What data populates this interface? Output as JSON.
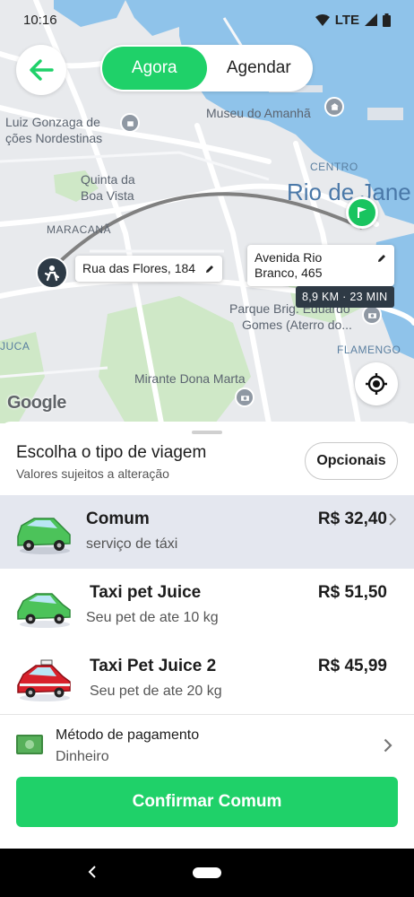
{
  "status_bar": {
    "time": "10:16",
    "network": "LTE"
  },
  "mode_toggle": {
    "options": [
      "Agora",
      "Agendar"
    ],
    "selected": "Agora"
  },
  "map": {
    "labels": {
      "luiz_gonzaga": "Luiz Gonzaga de",
      "coes_nordestinas": "ções Nordestinas",
      "museu": "Museu do Amanhã",
      "centro": "CENTRO",
      "rio": "Rio de Jane",
      "quinta": "Quinta da",
      "boa_vista": "Boa Vista",
      "maracana": "MARACANÃ",
      "parque": "Parque Brig. Eduardo",
      "gomes": "Gomes (Aterro do...",
      "flamengo": "FLAMENGO",
      "juca": "JUCA",
      "mirante": "Mirante Dona Marta"
    },
    "origin_address": "Rua das Flores, 184",
    "destination_address": "Avenida Rio Branco, 465",
    "eta": "8,9 KM · 23 MIN",
    "attribution": "Google"
  },
  "sheet": {
    "title": "Escolha o tipo de viagem",
    "subtitle": "Valores sujeitos a alteração",
    "options_button": "Opcionais",
    "rides": [
      {
        "name": "Comum",
        "description": "serviço de táxi",
        "price": "R$ 32,40",
        "car_color": "#4cc35a",
        "selected": true
      },
      {
        "name": "Taxi  pet Juice",
        "description": "Seu pet de ate 10 kg",
        "price": "R$ 51,50",
        "car_color": "#4cc35a",
        "selected": false
      },
      {
        "name": "Taxi Pet Juice 2",
        "description": "Seu pet de ate 20 kg",
        "price": "R$ 45,99",
        "car_color": "#d8202a",
        "selected": false
      }
    ],
    "payment": {
      "label": "Método de pagamento",
      "value": "Dinheiro"
    },
    "confirm_button": "Confirmar Comum"
  },
  "colors": {
    "accent": "#1fd169",
    "dark_marker": "#2d3a46",
    "water": "#8fc3ea"
  }
}
